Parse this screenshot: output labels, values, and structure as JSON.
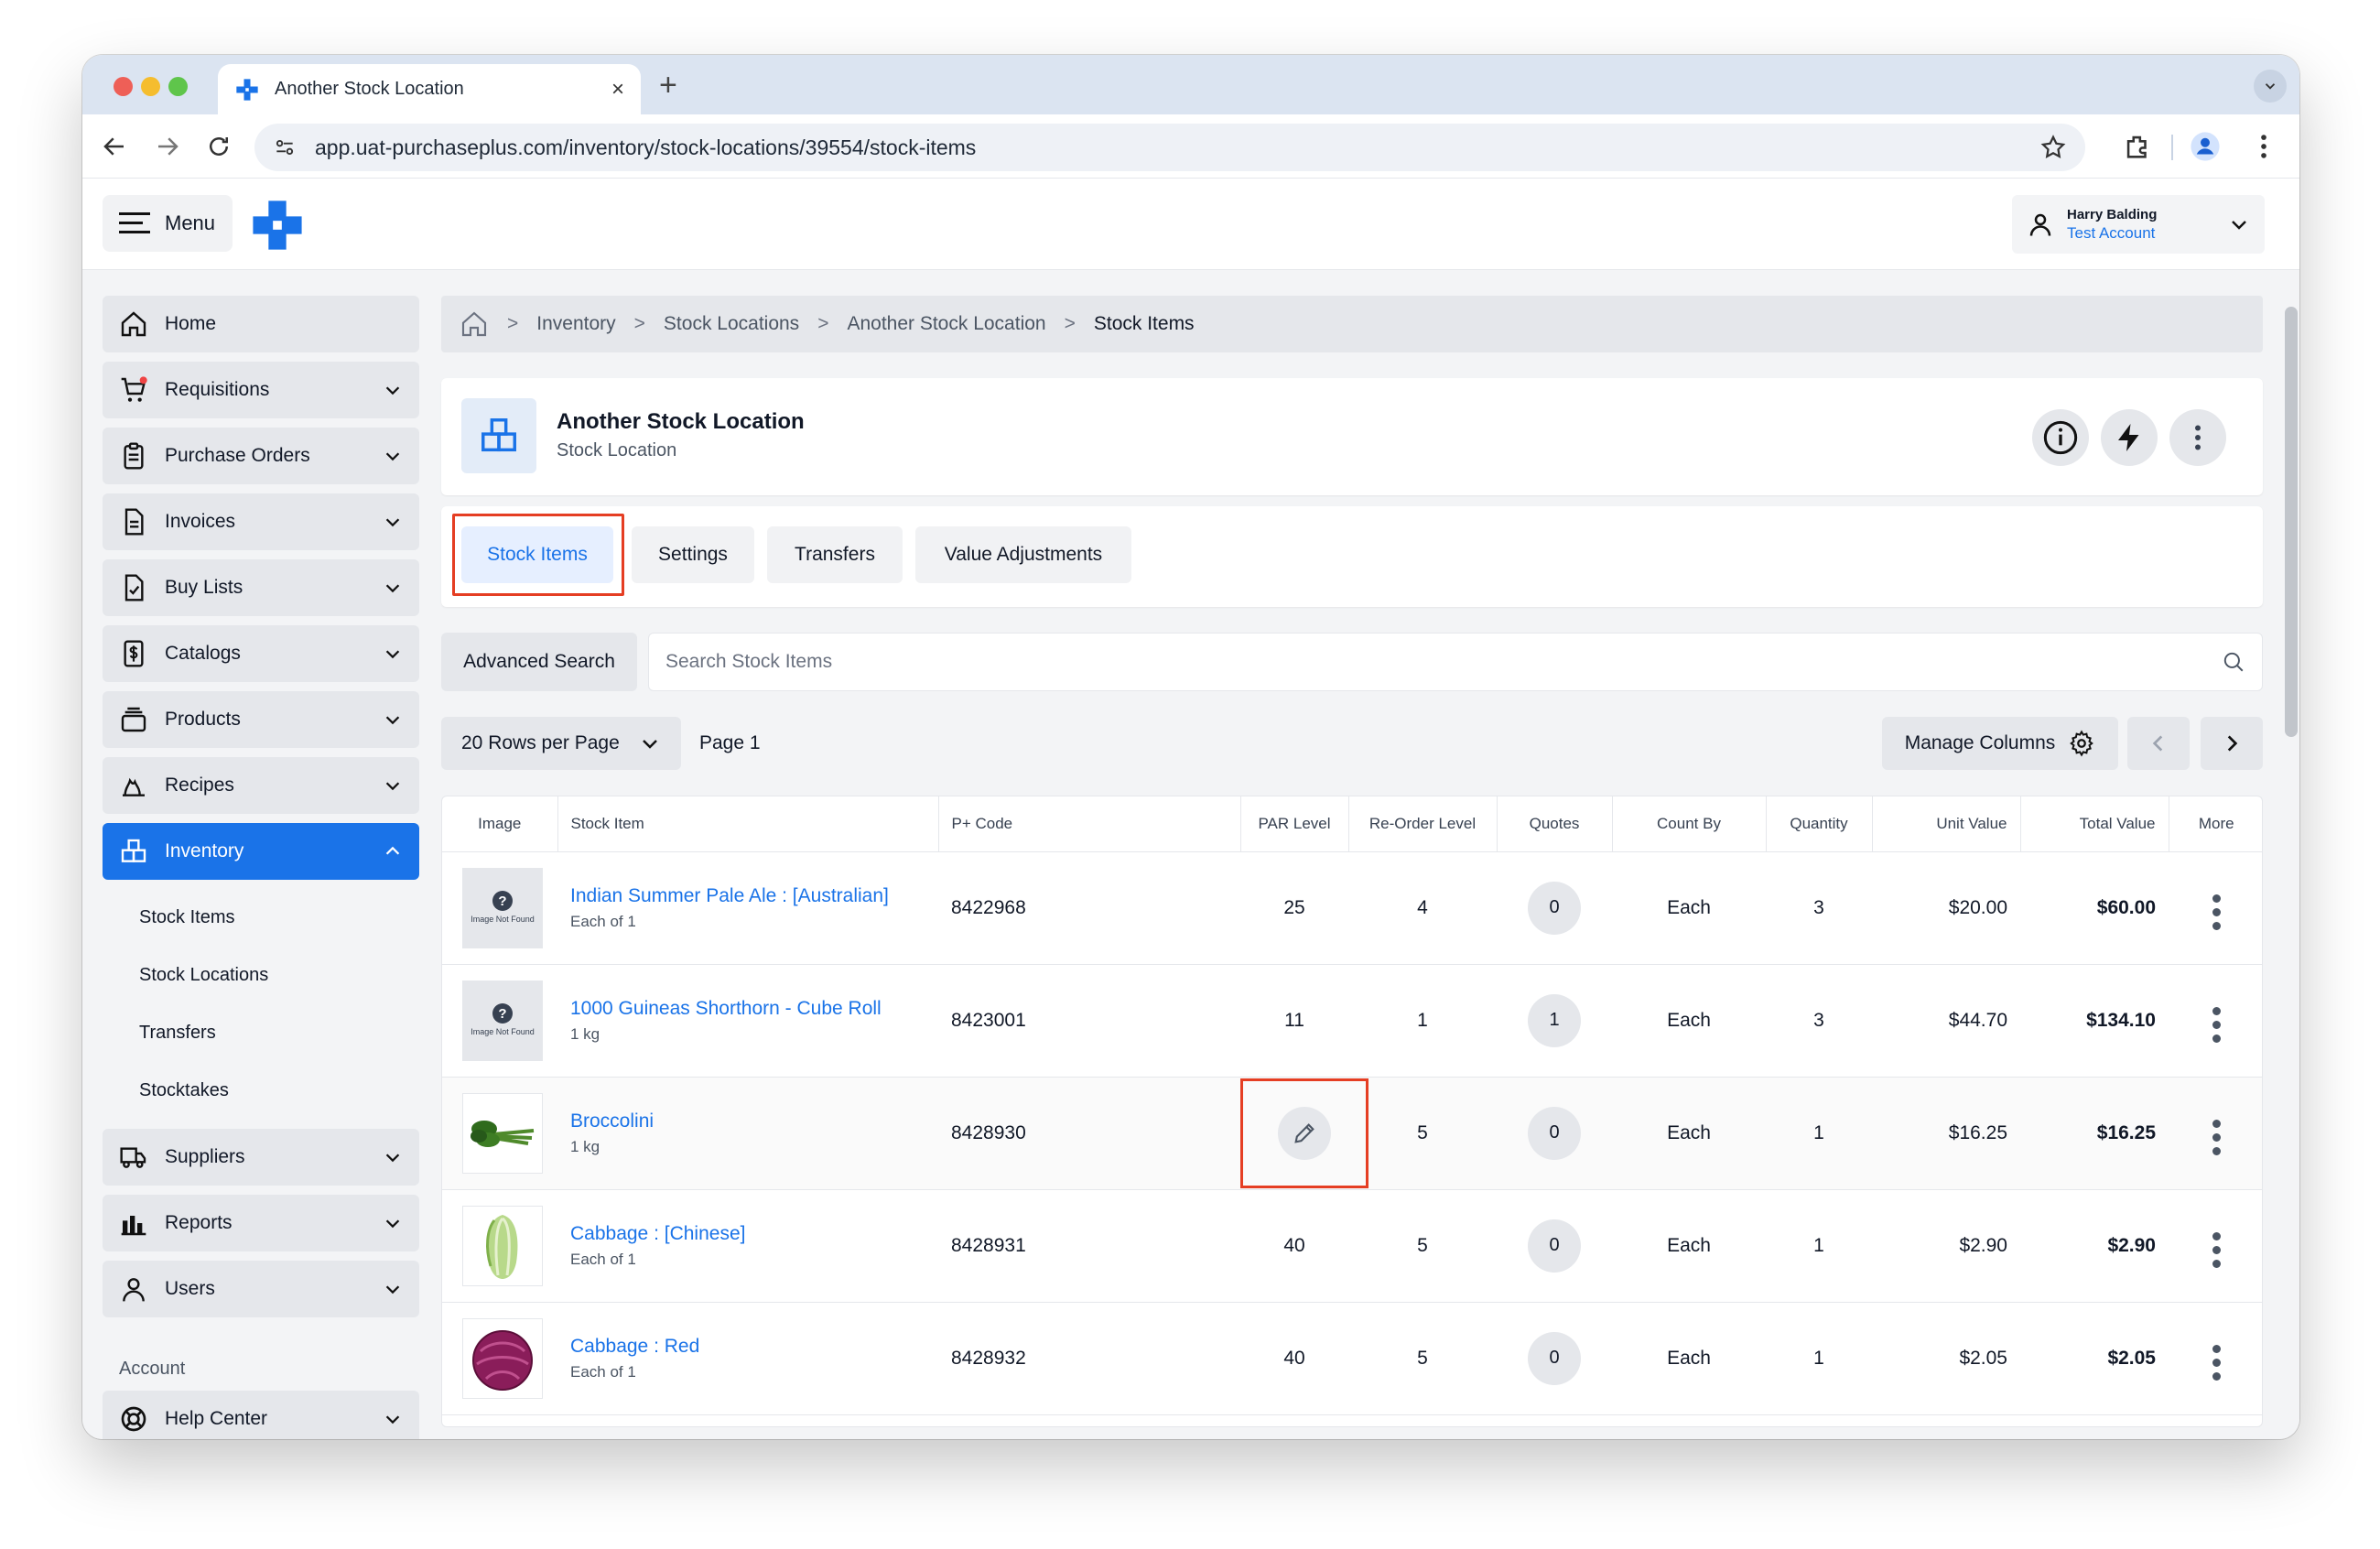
{
  "browser": {
    "tab_title": "Another Stock Location",
    "url": "app.uat-purchaseplus.com/inventory/stock-locations/39554/stock-items",
    "new_tab": "+",
    "close": "×"
  },
  "header": {
    "menu_label": "Menu",
    "user_name": "Harry Balding",
    "account": "Test Account"
  },
  "sidebar": {
    "items": [
      {
        "label": "Home",
        "icon": "home-icon"
      },
      {
        "label": "Requisitions",
        "icon": "cart-icon"
      },
      {
        "label": "Purchase Orders",
        "icon": "clipboard-icon"
      },
      {
        "label": "Invoices",
        "icon": "document-icon"
      },
      {
        "label": "Buy Lists",
        "icon": "checklist-icon"
      },
      {
        "label": "Catalogs",
        "icon": "dollar-doc-icon"
      },
      {
        "label": "Products",
        "icon": "box-icon"
      },
      {
        "label": "Recipes",
        "icon": "flame-icon"
      },
      {
        "label": "Inventory",
        "icon": "boxes-icon"
      }
    ],
    "inventory_sub": [
      "Stock Items",
      "Stock Locations",
      "Transfers",
      "Stocktakes"
    ],
    "more_items": [
      {
        "label": "Suppliers",
        "icon": "truck-icon"
      },
      {
        "label": "Reports",
        "icon": "bar-chart-icon"
      },
      {
        "label": "Users",
        "icon": "user-icon"
      }
    ],
    "account_section": "Account",
    "help": {
      "label": "Help Center",
      "icon": "lifebuoy-icon"
    }
  },
  "breadcrumb": [
    "Inventory",
    "Stock Locations",
    "Another Stock Location",
    "Stock Items"
  ],
  "location": {
    "title": "Another Stock Location",
    "subtitle": "Stock Location"
  },
  "tabs": [
    "Stock Items",
    "Settings",
    "Transfers",
    "Value Adjustments"
  ],
  "search": {
    "advanced_label": "Advanced Search",
    "placeholder": "Search Stock Items"
  },
  "pager": {
    "rows_label": "20 Rows per Page",
    "page_label": "Page 1",
    "manage_label": "Manage Columns"
  },
  "table": {
    "headers": [
      "Image",
      "Stock Item",
      "P+ Code",
      "PAR Level",
      "Re-Order Level",
      "Quotes",
      "Count By",
      "Quantity",
      "Unit Value",
      "Total Value",
      "More"
    ],
    "not_found_text": "Image Not Found",
    "rows": [
      {
        "name": "Indian Summer Pale Ale : [Australian]",
        "desc": "Each of 1",
        "code": "8422968",
        "par": "25",
        "reorder": "4",
        "quotes": "0",
        "count_by": "Each",
        "qty": "3",
        "unit": "$20.00",
        "total": "$60.00",
        "image": "not-found"
      },
      {
        "name": "1000 Guineas Shorthorn - Cube Roll",
        "desc": "1 kg",
        "code": "8423001",
        "par": "11",
        "reorder": "1",
        "quotes": "1",
        "count_by": "Each",
        "qty": "3",
        "unit": "$44.70",
        "total": "$134.10",
        "image": "not-found"
      },
      {
        "name": "Broccolini",
        "desc": "1 kg",
        "code": "8428930",
        "par": "",
        "reorder": "5",
        "quotes": "0",
        "count_by": "Each",
        "qty": "1",
        "unit": "$16.25",
        "total": "$16.25",
        "image": "broccolini"
      },
      {
        "name": "Cabbage : [Chinese]",
        "desc": "Each of 1",
        "code": "8428931",
        "par": "40",
        "reorder": "5",
        "quotes": "0",
        "count_by": "Each",
        "qty": "1",
        "unit": "$2.90",
        "total": "$2.90",
        "image": "chinese-cabbage"
      },
      {
        "name": "Cabbage : Red",
        "desc": "Each of 1",
        "code": "8428932",
        "par": "40",
        "reorder": "5",
        "quotes": "0",
        "count_by": "Each",
        "qty": "1",
        "unit": "$2.05",
        "total": "$2.05",
        "image": "red-cabbage"
      }
    ]
  },
  "colors": {
    "accent": "#1a73e8",
    "highlight": "#e53e23"
  }
}
